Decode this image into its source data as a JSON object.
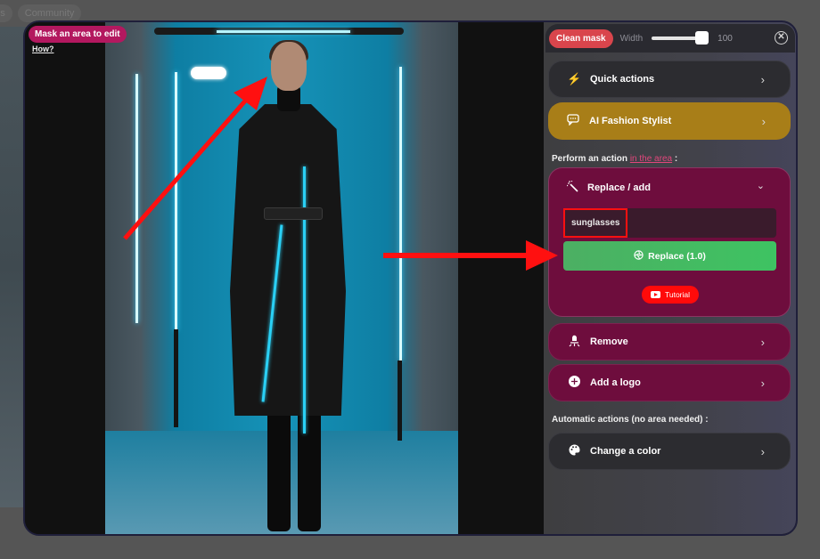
{
  "background": {
    "nav_items": [
      "ads",
      "Community"
    ]
  },
  "canvas": {
    "mask_badge": "Mask an area to edit",
    "how_link": "How?"
  },
  "toolbar": {
    "clean_mask_label": "Clean mask",
    "width_label": "Width",
    "width_value": "100",
    "width_fraction": 1.0,
    "close_icon": "close-circle-icon"
  },
  "panel": {
    "quick_actions": {
      "label": "Quick actions",
      "icon": "lightning-icon"
    },
    "fashion_stylist": {
      "label": "AI Fashion Stylist",
      "icon": "chat-icon"
    },
    "area_section": {
      "prefix": "Perform an action ",
      "link": "in the area",
      "suffix": " :"
    },
    "replace_add": {
      "label": "Replace / add",
      "icon": "magic-wand-icon",
      "input_value": "sunglasses",
      "button_label": "Replace (1.0)",
      "tutorial_label": "Tutorial"
    },
    "remove": {
      "label": "Remove",
      "icon": "eraser-icon"
    },
    "add_logo": {
      "label": "Add a logo",
      "icon": "plus-circle-icon"
    },
    "auto_section": "Automatic actions (no area needed) :",
    "change_color": {
      "label": "Change a color",
      "icon": "palette-icon"
    }
  },
  "colors": {
    "accent_pink": "#b3185f",
    "clean_mask_red": "#d9454c",
    "gold": "#a87e18",
    "plum": "#6e0d3d",
    "green": "#3ec362",
    "annotation_red": "#ff1010"
  }
}
